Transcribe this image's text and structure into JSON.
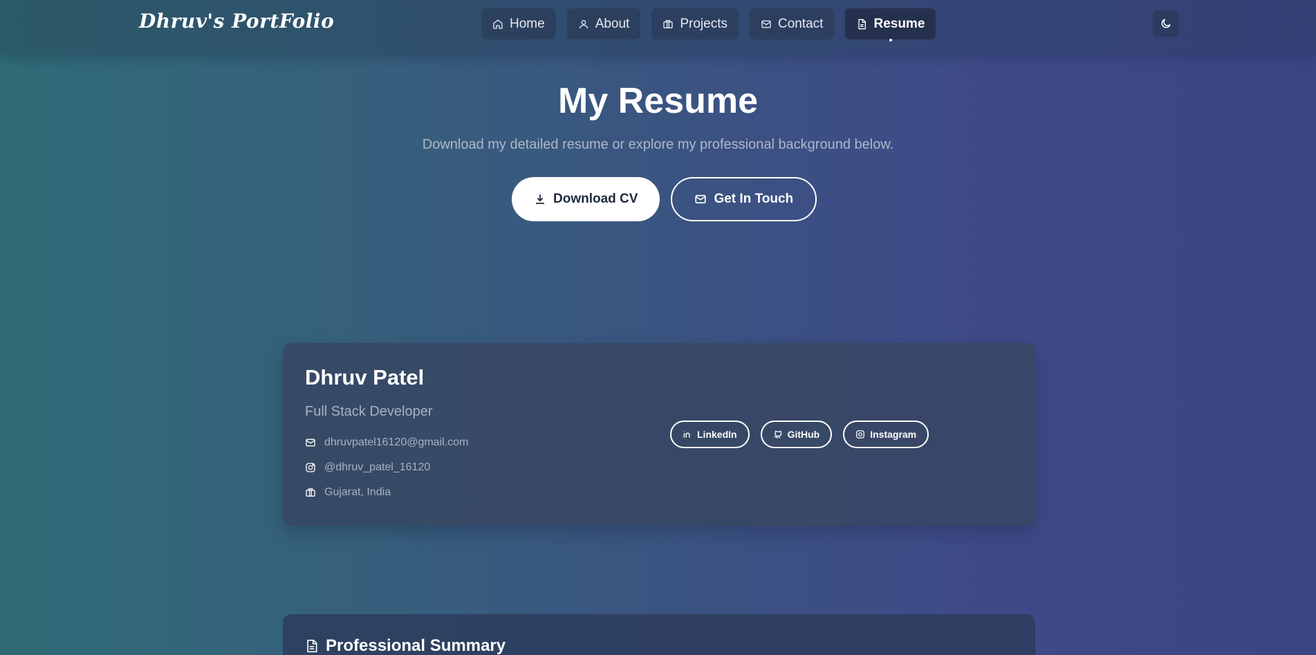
{
  "nav": {
    "logo": "Dhruv's PortFolio",
    "items": [
      {
        "label": "Home",
        "icon": "home-icon"
      },
      {
        "label": "About",
        "icon": "user-icon"
      },
      {
        "label": "Projects",
        "icon": "briefcase-icon"
      },
      {
        "label": "Contact",
        "icon": "mail-icon"
      },
      {
        "label": "Resume",
        "icon": "document-icon",
        "active": true
      }
    ],
    "theme_toggle_icon": "moon-icon"
  },
  "hero": {
    "title": "My Resume",
    "subtitle": "Download my detailed resume or explore my professional background below.",
    "download_label": "Download CV",
    "contact_label": "Get In Touch"
  },
  "profile": {
    "name": "Dhruv Patel",
    "role": "Full Stack Developer",
    "email": "dhruvpatel16120@gmail.com",
    "instagram_handle": "@dhruv_patel_16120",
    "location": "Gujarat, India",
    "socials": [
      {
        "label": "LinkedIn",
        "icon": "linkedin-icon"
      },
      {
        "label": "GitHub",
        "icon": "github-icon"
      },
      {
        "label": "Instagram",
        "icon": "instagram-icon"
      }
    ]
  },
  "summary": {
    "title": "Professional Summary"
  },
  "colors": {
    "accent": "#ffffff",
    "muted_text": "#a7b1c2",
    "card_bg": "#374662"
  }
}
